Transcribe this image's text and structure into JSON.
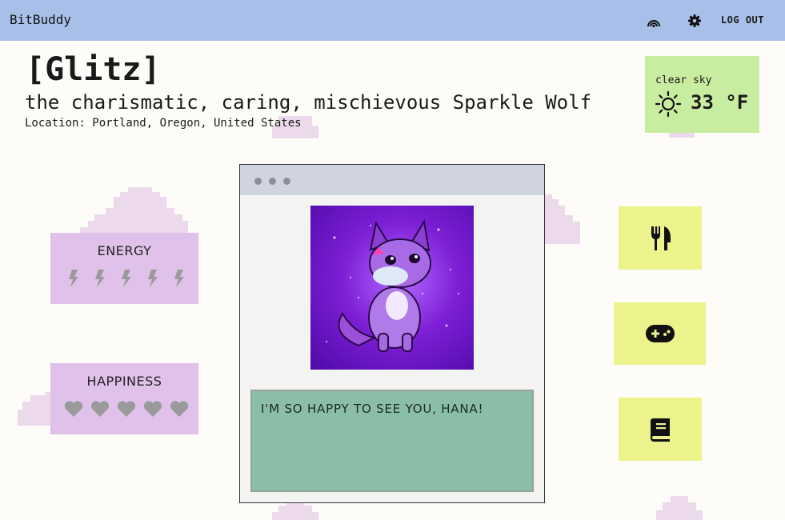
{
  "app": {
    "brand": "BitBuddy"
  },
  "nav": {
    "signal_icon": "signal-icon",
    "settings_icon": "gear-icon",
    "logout_label": "LOG OUT"
  },
  "pet": {
    "name": "[Glitz]",
    "description": "the charismatic, caring, mischievous Sparkle Wolf",
    "location": "Location: Portland, Oregon, United States",
    "image_icon": "sparkle-wolf-portrait"
  },
  "weather": {
    "condition": "clear sky",
    "temperature": "33 °F",
    "icon": "sun-icon"
  },
  "stats": {
    "energy": {
      "label": "ENERGY",
      "level": 5,
      "max": 5,
      "icon": "lightning-icon"
    },
    "happiness": {
      "label": "HAPPINESS",
      "level": 5,
      "max": 5,
      "icon": "heart-icon"
    }
  },
  "window": {
    "message": "I'M SO HAPPY TO SEE YOU, HANA!"
  },
  "actions": [
    {
      "name": "feed",
      "icon": "fork-knife-icon"
    },
    {
      "name": "play",
      "icon": "gamepad-icon"
    },
    {
      "name": "read",
      "icon": "book-icon"
    }
  ],
  "colors": {
    "nav": "#a8c0e9",
    "weather_card": "#c9eda0",
    "stat_card": "#dfc1ea",
    "action_button": "#ecf28c",
    "speech_box": "#8abea8",
    "stat_icon": "#9a9a9a"
  }
}
